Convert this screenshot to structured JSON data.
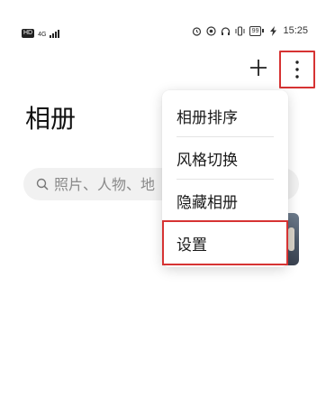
{
  "status_bar": {
    "hd_badge": "HD",
    "network_label": "4G",
    "battery_level": "99",
    "time": "15:25",
    "icons": [
      "hd-icon",
      "signal-icon",
      "alarm-icon",
      "eye-comfort-icon",
      "headphones-icon",
      "vibrate-icon",
      "battery-icon",
      "charging-icon"
    ]
  },
  "toolbar": {
    "add_icon": "plus-icon",
    "more_icon": "more-vertical-icon"
  },
  "page": {
    "title": "相册"
  },
  "search": {
    "placeholder": "照片、人物、地",
    "value": ""
  },
  "menu": {
    "items": [
      {
        "label": "相册排序"
      },
      {
        "label": "风格切换"
      },
      {
        "label": "隐藏相册"
      },
      {
        "label": "设置"
      }
    ]
  },
  "colors": {
    "highlight": "#d63333",
    "background": "#ffffff",
    "search_bg": "#f1f1f1",
    "text": "#1a1a1a"
  }
}
